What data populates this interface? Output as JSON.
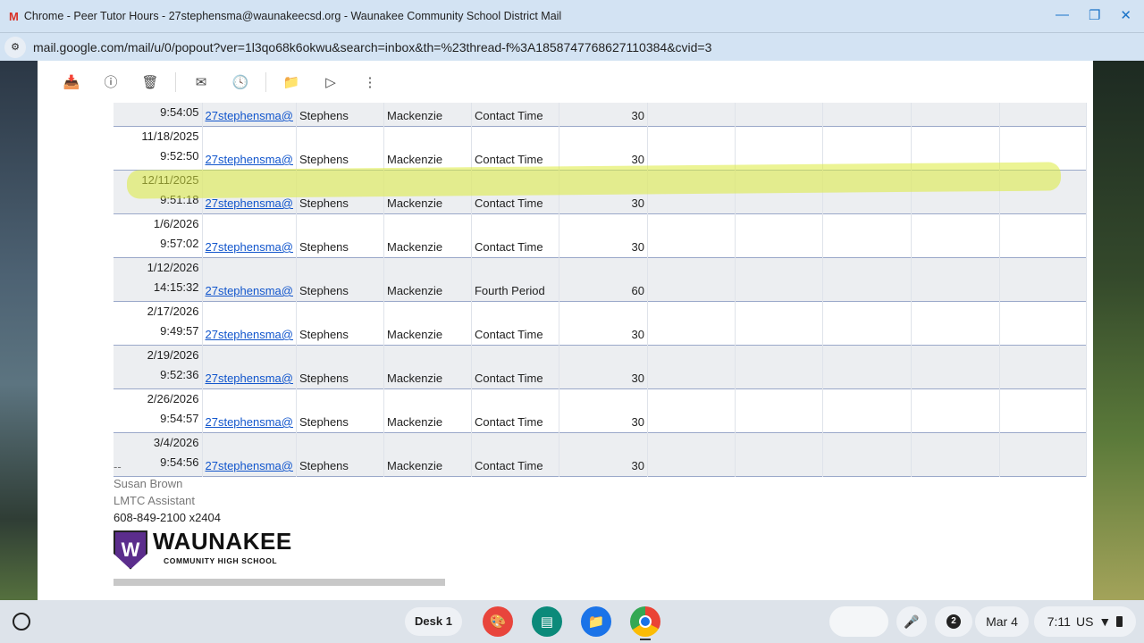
{
  "window": {
    "title": "Chrome - Peer Tutor Hours - 27stephensma@waunakeecsd.org - Waunakee Community School District Mail",
    "url": "mail.google.com/mail/u/0/popout?ver=1l3qo68k6okwu&search=inbox&th=%23thread-f%3A1858747768627110384&cvid=3"
  },
  "toolbar": [
    "archive-icon",
    "report-spam-icon",
    "delete-icon",
    "mark-unread-icon",
    "snooze-icon",
    "move-to-icon",
    "label-icon",
    "more-icon"
  ],
  "rows": [
    {
      "date": "",
      "time": "9:54:05",
      "email": "27stephensma@",
      "last": "Stephens",
      "first": "Mackenzie",
      "type": "Contact Time",
      "minutes": "30"
    },
    {
      "date": "11/18/2025",
      "time": "9:52:50",
      "email": "27stephensma@",
      "last": "Stephens",
      "first": "Mackenzie",
      "type": "Contact Time",
      "minutes": "30"
    },
    {
      "date": "12/11/2025",
      "time": "9:51:18",
      "email": "27stephensma@",
      "last": "Stephens",
      "first": "Mackenzie",
      "type": "Contact Time",
      "minutes": "30"
    },
    {
      "date": "1/6/2026",
      "time": "9:57:02",
      "email": "27stephensma@",
      "last": "Stephens",
      "first": "Mackenzie",
      "type": "Contact Time",
      "minutes": "30"
    },
    {
      "date": "1/12/2026",
      "time": "14:15:32",
      "email": "27stephensma@",
      "last": "Stephens",
      "first": "Mackenzie",
      "type": "Fourth Period",
      "minutes": "60"
    },
    {
      "date": "2/17/2026",
      "time": "9:49:57",
      "email": "27stephensma@",
      "last": "Stephens",
      "first": "Mackenzie",
      "type": "Contact Time",
      "minutes": "30"
    },
    {
      "date": "2/19/2026",
      "time": "9:52:36",
      "email": "27stephensma@",
      "last": "Stephens",
      "first": "Mackenzie",
      "type": "Contact Time",
      "minutes": "30"
    },
    {
      "date": "2/26/2026",
      "time": "9:54:57",
      "email": "27stephensma@",
      "last": "Stephens",
      "first": "Mackenzie",
      "type": "Contact Time",
      "minutes": "30"
    },
    {
      "date": "3/4/2026",
      "time": "9:54:56",
      "email": "27stephensma@",
      "last": "Stephens",
      "first": "Mackenzie",
      "type": "Contact Time",
      "minutes": "30"
    }
  ],
  "signature": {
    "dash": "--",
    "name": "Susan Brown",
    "role": "LMTC Assistant",
    "phone": "608-849-2100 x2404",
    "logo_main": "WAUNAKEE",
    "logo_sub": "COMMUNITY HIGH SCHOOL",
    "logo_letter": "W"
  },
  "shelf": {
    "desk": "Desk 1",
    "notifications": "2",
    "date": "Mar 4",
    "time": "7:11",
    "locale": "US"
  }
}
